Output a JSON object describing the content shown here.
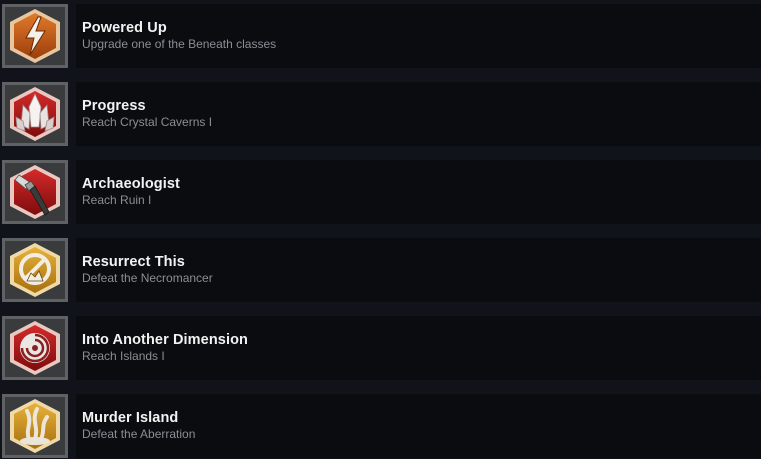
{
  "achievements": [
    {
      "title": "Powered Up",
      "description": "Upgrade one of the Beneath classes",
      "icon": "lightning-bolt-icon",
      "color": "#c8601a"
    },
    {
      "title": "Progress",
      "description": "Reach Crystal Caverns I",
      "icon": "crystal-icon",
      "color": "#b01818"
    },
    {
      "title": "Archaeologist",
      "description": "Reach Ruin I",
      "icon": "brush-icon",
      "color": "#b01818"
    },
    {
      "title": "Resurrect This",
      "description": "Defeat the Necromancer",
      "icon": "no-resurrect-icon",
      "color": "#c8961e"
    },
    {
      "title": "Into Another Dimension",
      "description": "Reach Islands I",
      "icon": "vortex-icon",
      "color": "#b01818"
    },
    {
      "title": "Murder Island",
      "description": "Defeat the Aberration",
      "icon": "tentacles-icon",
      "color": "#c8961e"
    }
  ]
}
